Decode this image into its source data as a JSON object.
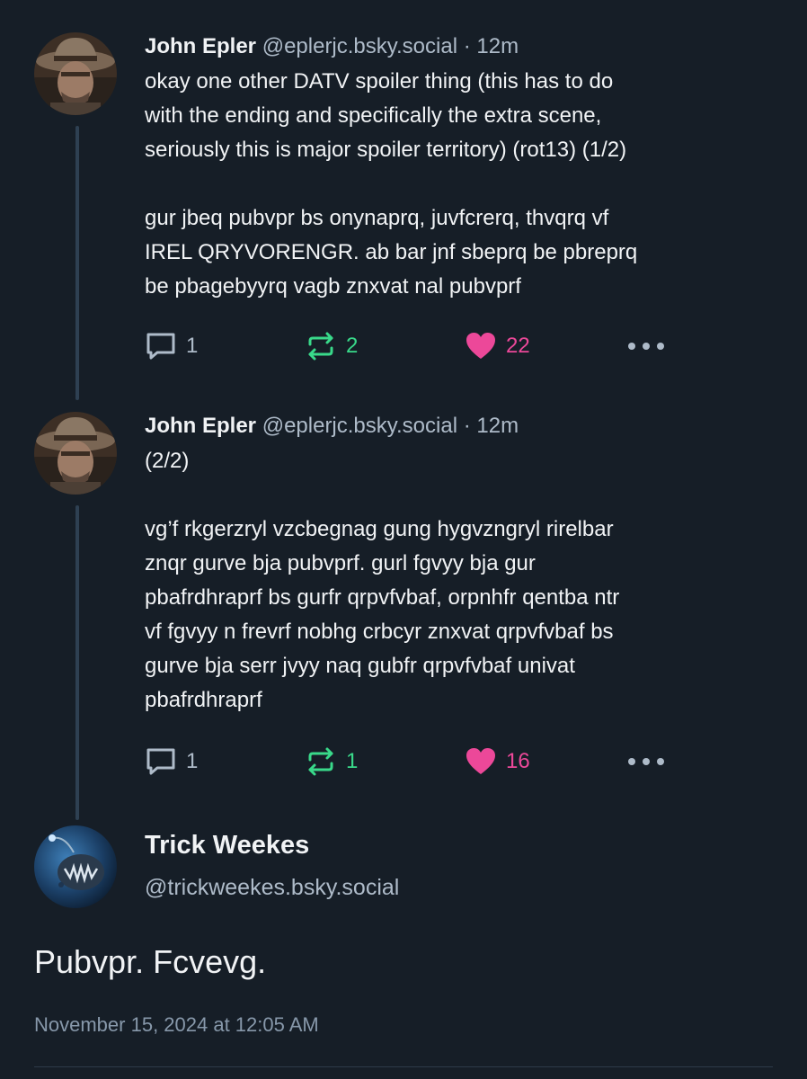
{
  "thread": [
    {
      "author": "John Epler",
      "handle": "@eplerjc.bsky.social",
      "separator": "·",
      "time": "12m",
      "paragraphs": [
        [
          "okay one other DATV spoiler thing (this has to do",
          "with the ending and specifically the extra scene,",
          "seriously this is major spoiler territory) (rot13) (1/2)"
        ],
        [
          "gur jbeq pubvpr bs onynaprq, juvfcrerq, thvqrq vf",
          "IREL QRYVORENGR. ab bar jnf sbeprq be pbreprq",
          "be pbagebyyrq vagb znxvat nal pubvprf"
        ]
      ],
      "replies": "1",
      "reposts": "2",
      "likes": "22"
    },
    {
      "author": "John Epler",
      "handle": "@eplerjc.bsky.social",
      "separator": "·",
      "time": "12m",
      "paragraphs": [
        [
          "(2/2)"
        ],
        [
          "vg’f rkgerzryl vzcbegnag gung hygvzngryl rirelbar",
          "znqr gurve bja pubvprf. gurl fgvyy bja gur",
          "pbafrdhraprf bs gurfr qrpvfvbaf, orpnhfr qentba ntr",
          "vf fgvyy n frevrf nobhg crbcyr znxvat qrpvfvbaf bs",
          "gurve bja serr jvyy naq gubfr qrpvfvbaf univat",
          "pbafrdhraprf"
        ]
      ],
      "replies": "1",
      "reposts": "1",
      "likes": "16"
    }
  ],
  "main": {
    "author": "Trick Weekes",
    "handle": "@trickweekes.bsky.social",
    "text": "Pubvpr. Fcvevg.",
    "timestamp": "November 15, 2024 at 12:05 AM"
  },
  "colors": {
    "background": "#161e27",
    "text": "#f1f3f5",
    "muted": "#aebbc9",
    "repost": "#39d98a",
    "like": "#ec4899",
    "thread_line": "#2e4052"
  },
  "icons": {
    "reply": "speech-bubble-icon",
    "repost": "repost-arrows-icon",
    "like": "heart-icon",
    "more": "ellipsis-icon"
  }
}
